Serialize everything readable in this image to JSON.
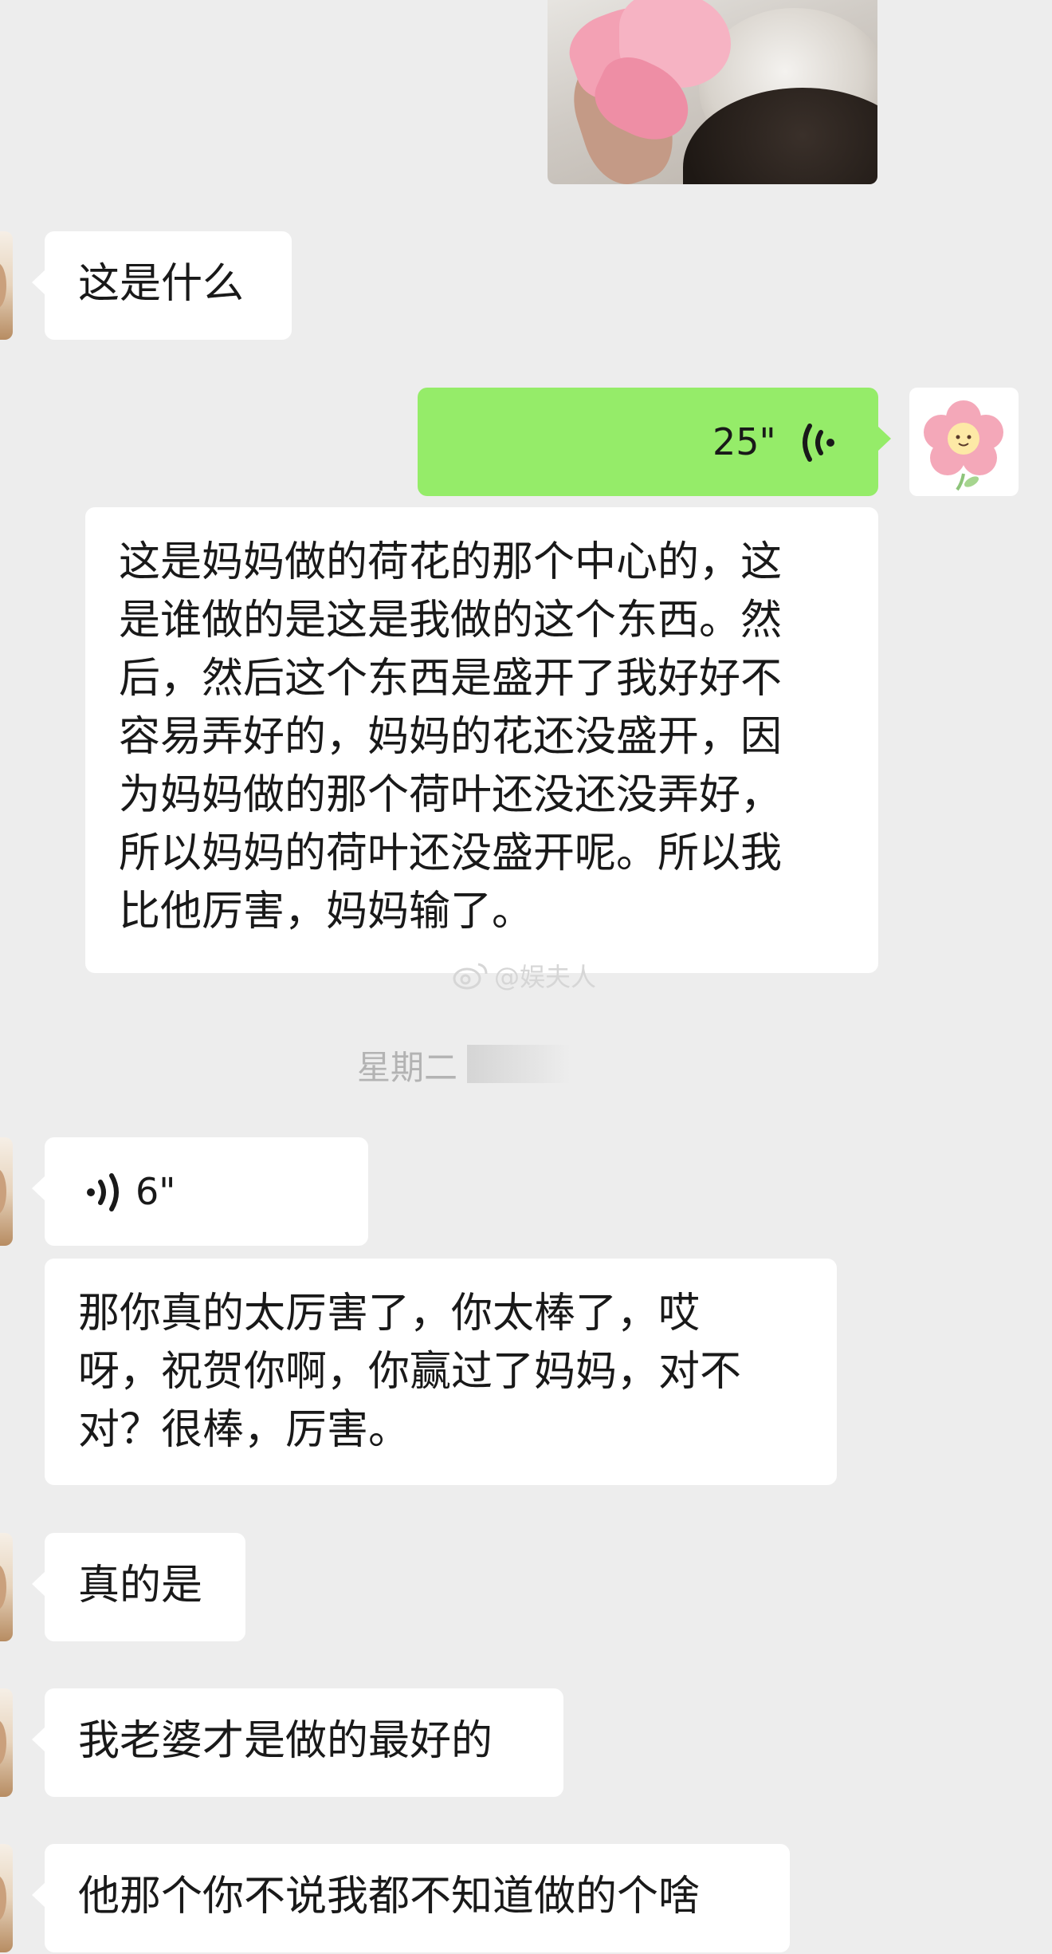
{
  "messages": {
    "m1_text": "这是什么",
    "m2_voice_duration": "25\"",
    "m2_transcript": "这是妈妈做的荷花的那个中心的，这\n是谁做的是这是我做的这个东西。然\n后，然后这个东西是盛开了我好好不\n容易弄好的，妈妈的花还没盛开，因\n为妈妈做的那个荷叶还没还没弄好，\n所以妈妈的荷叶还没盛开呢。所以我\n比他厉害，妈妈输了。",
    "timestamp": "星期二",
    "m3_voice_duration": "6\"",
    "m3_transcript": "那你真的太厉害了，你太棒了，哎\n呀，祝贺你啊，你赢过了妈妈，对不\n对？很棒，厉害。",
    "m4_text": "真的是",
    "m5_text": "我老婆才是做的最好的",
    "m6_text": "他那个你不说我都不知道做的个啥"
  },
  "watermark": "@娱夫人",
  "colors": {
    "background": "#ededed",
    "self_bubble": "#95ec69",
    "other_bubble": "#ffffff"
  },
  "icons": [
    "photo-thumbnail",
    "flower-avatar-icon",
    "voice-wave-icon",
    "weibo-icon"
  ]
}
